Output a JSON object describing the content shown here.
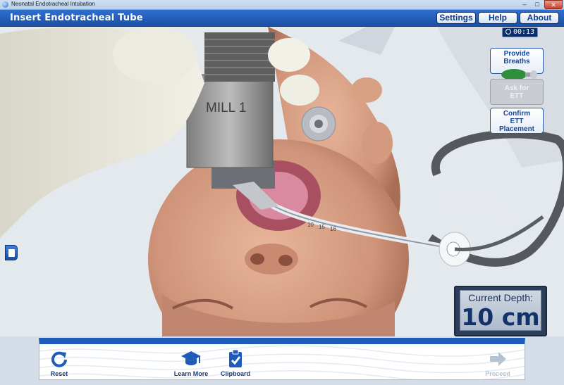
{
  "window": {
    "title": "Neonatal Endotracheal Intubation",
    "min": "–",
    "max": "□",
    "close": "✕"
  },
  "header": {
    "title": "Insert Endotracheal Tube",
    "settings": "Settings",
    "help": "Help",
    "about": "About"
  },
  "timer": {
    "value": "00:13"
  },
  "side_buttons": {
    "provide_breaths": "Provide Breaths",
    "ask_for_ett": [
      "Ask for",
      "ETT"
    ],
    "confirm_ett": [
      "Confirm",
      "ETT",
      "Placement"
    ]
  },
  "scene": {
    "laryngoscope_label": "MILL 1",
    "tube_marks": [
      "10",
      "15",
      "16"
    ]
  },
  "depth": {
    "label": "Current Depth:",
    "value": "10 cm"
  },
  "toolbar": {
    "reset": "Reset",
    "learn_more": "Learn More",
    "clipboard": "Clipboard",
    "proceed": "Proceed"
  },
  "icons": {
    "reset": "refresh-icon",
    "learn_more": "graduation-cap-icon",
    "clipboard": "clipboard-check-icon",
    "proceed": "arrow-right-icon",
    "drawer": "notes-drawer-icon",
    "timer": "clock-icon",
    "provide_breaths": "bag-valve-mask-icon"
  },
  "colors": {
    "header_blue": "#1f5bb8",
    "button_text": "#1346a0",
    "disabled": "#c9cdd2"
  }
}
